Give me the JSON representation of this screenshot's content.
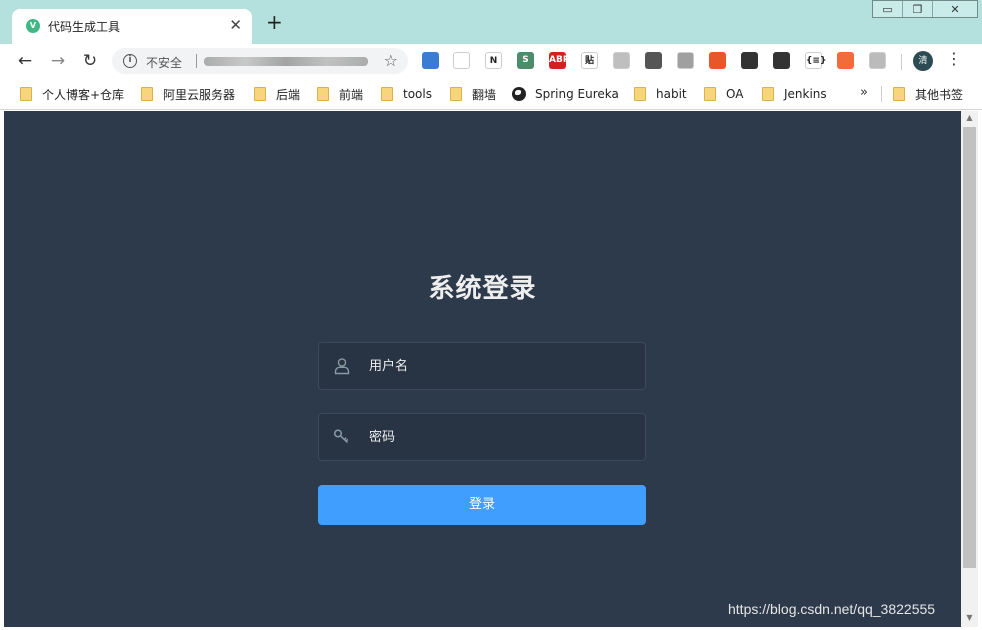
{
  "tab": {
    "title": "代码生成工具",
    "favicon": "V"
  },
  "address_bar": {
    "security_label": "不安全"
  },
  "window_controls": {
    "minimize": "▭",
    "restore": "❐",
    "close": "✕"
  },
  "extensions": [
    {
      "name": "translate-extension-icon",
      "label": "",
      "color": "#3b7bd4"
    },
    {
      "name": "feather-extension-icon",
      "label": "",
      "color": "#ffffff"
    },
    {
      "name": "notion-extension-icon",
      "label": "N",
      "color": "#ffffff"
    },
    {
      "name": "s-extension-icon",
      "label": "S",
      "color": "#4c8c6a"
    },
    {
      "name": "adblock-plus-icon",
      "label": "ABP",
      "color": "#d32020"
    },
    {
      "name": "tie-extension-icon",
      "label": "贴",
      "color": "#ffffff"
    },
    {
      "name": "shield-extension-icon",
      "label": "",
      "color": "#bfbfbf"
    },
    {
      "name": "qr-code-extension-icon",
      "label": "",
      "color": "#555555"
    },
    {
      "name": "leaf-extension-icon",
      "label": "",
      "color": "#a0a0a0"
    },
    {
      "name": "tampermonkey-extension-icon",
      "label": "",
      "color": "#e8572a"
    },
    {
      "name": "drum-extension-icon",
      "label": "",
      "color": "#333333"
    },
    {
      "name": "vue-devtools-extension-icon",
      "label": "",
      "color": "#333333"
    },
    {
      "name": "json-extension-icon",
      "label": "{≡}",
      "color": "#ffffff"
    },
    {
      "name": "postman-extension-icon",
      "label": "",
      "color": "#f26b3a"
    },
    {
      "name": "tree-extension-icon",
      "label": "",
      "color": "#bbbbbb"
    }
  ],
  "profile": {
    "initial": "清"
  },
  "bookmarks": [
    {
      "label": "个人博客+仓库",
      "icon": "folder-icon"
    },
    {
      "label": "阿里云服务器",
      "icon": "folder-icon"
    },
    {
      "label": "后端",
      "icon": "folder-icon"
    },
    {
      "label": "前端",
      "icon": "folder-icon"
    },
    {
      "label": "tools",
      "icon": "folder-icon"
    },
    {
      "label": "翻墙",
      "icon": "folder-icon"
    },
    {
      "label": "Spring Eureka",
      "icon": "globe-icon"
    },
    {
      "label": "habit",
      "icon": "folder-icon"
    },
    {
      "label": "OA",
      "icon": "folder-icon"
    },
    {
      "label": "Jenkins",
      "icon": "folder-icon"
    }
  ],
  "bookmarks_more": "»",
  "other_bookmarks": "其他书签",
  "login": {
    "title": "系统登录",
    "username_placeholder": "用户名",
    "password_placeholder": "密码",
    "submit_label": "登录"
  },
  "watermark": "https://blog.csdn.net/qq_3822555",
  "colors": {
    "page_bg": "#2d3a4b",
    "input_bg": "#283443",
    "button_bg": "#409eff",
    "browser_frame": "#b4e1dd"
  }
}
